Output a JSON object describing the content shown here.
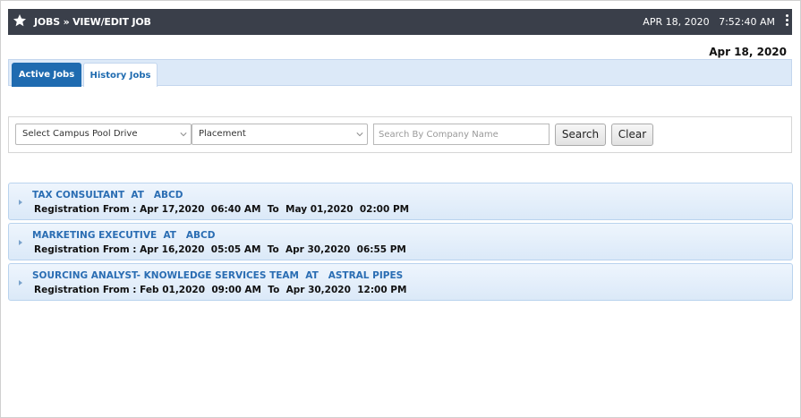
{
  "header": {
    "breadcrumb": "JOBS » VIEW/EDIT JOB",
    "clock": "APR 18, 2020   7:52:40 AM"
  },
  "page_date": "Apr 18, 2020",
  "tabs": {
    "active": "Active Jobs",
    "history": "History Jobs"
  },
  "filters": {
    "campus_pool": "Select Campus Pool Drive",
    "type": "Placement",
    "company_placeholder": "Search By Company Name",
    "search_label": "Search",
    "clear_label": "Clear"
  },
  "jobs": [
    {
      "title": "TAX CONSULTANT  AT   ABCD",
      "registration": "Registration From : Apr 17,2020  06:40 AM  To  May 01,2020  02:00 PM"
    },
    {
      "title": "MARKETING EXECUTIVE  AT   ABCD",
      "registration": "Registration From : Apr 16,2020  05:05 AM  To  Apr 30,2020  06:55 PM"
    },
    {
      "title": "SOURCING ANALYST- KNOWLEDGE SERVICES TEAM  AT   ASTRAL PIPES",
      "registration": "Registration From : Feb 01,2020  09:00 AM  To  Apr 30,2020  12:00 PM"
    }
  ],
  "colors": {
    "topbar": "#3a3f4a",
    "accent": "#1f6bb0",
    "tabbar": "#dce9f8"
  }
}
